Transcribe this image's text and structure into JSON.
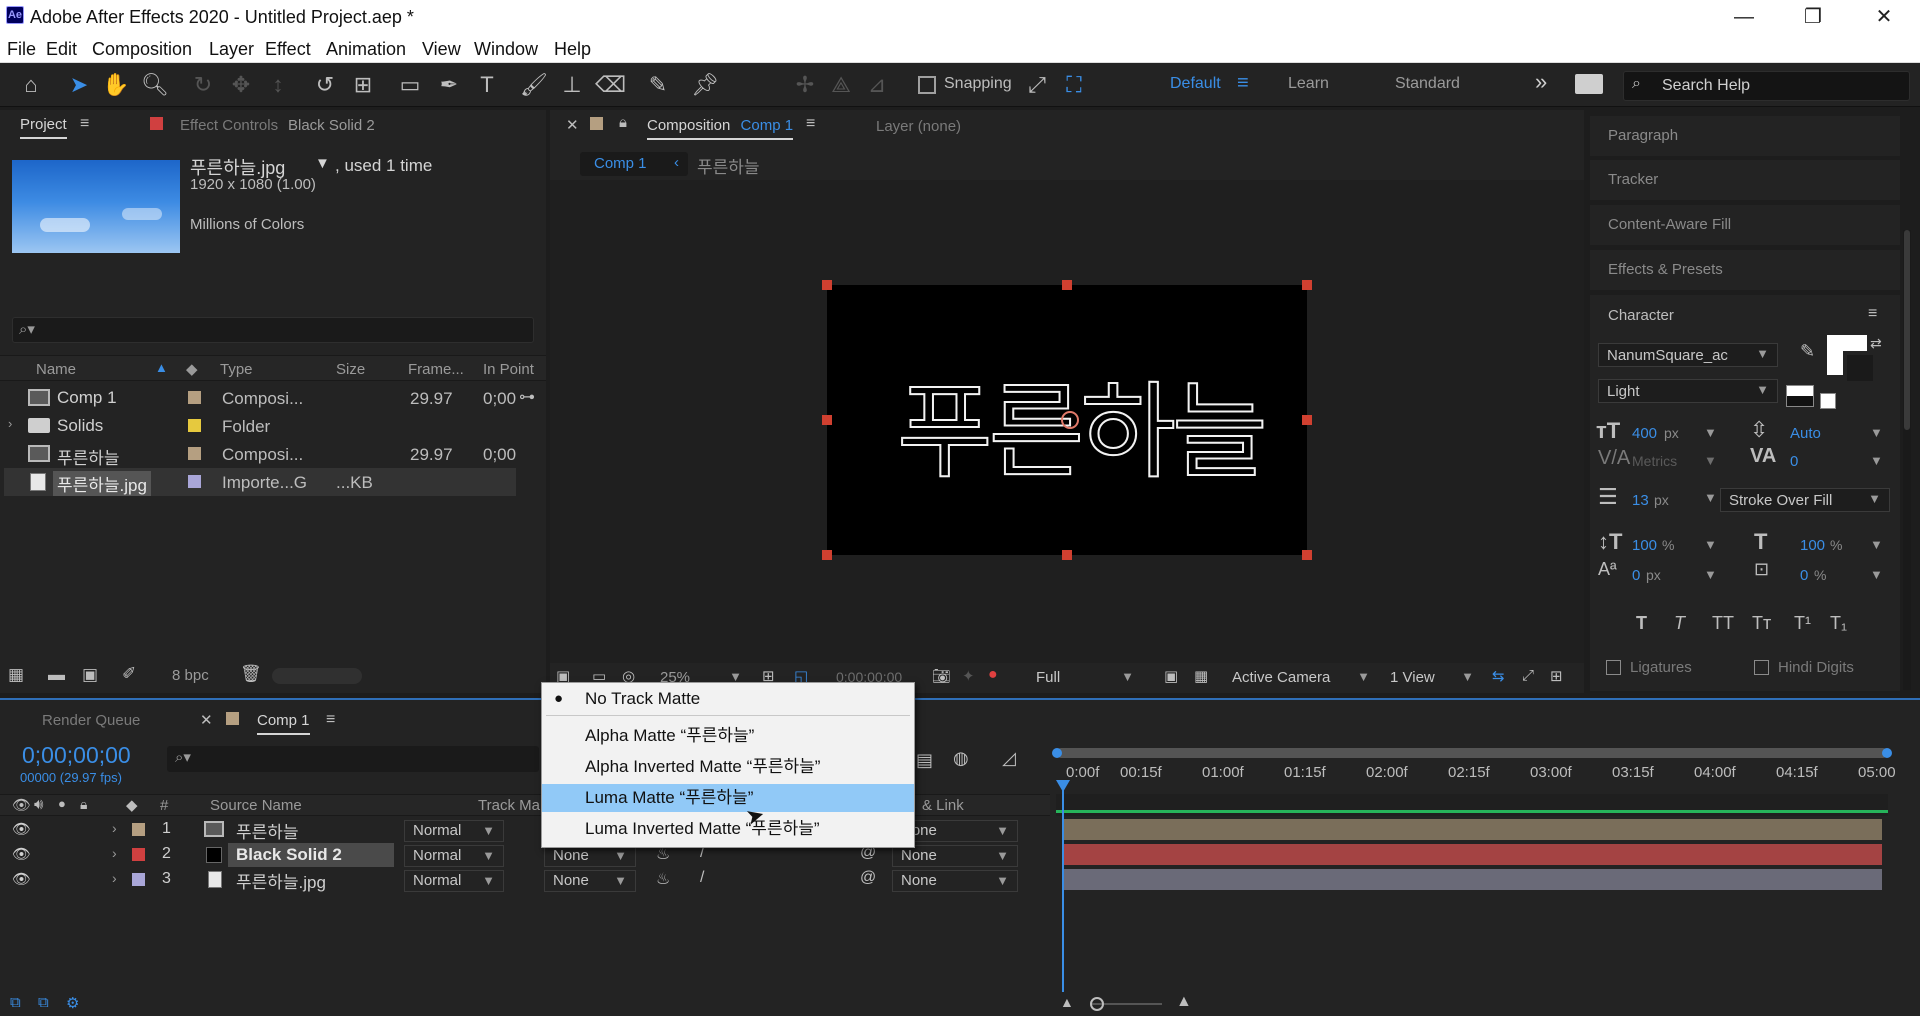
{
  "app": {
    "logo": "Ae",
    "title": "Adobe After Effects 2020 - Untitled Project.aep *",
    "window_controls": {
      "minimize": "—",
      "restore": "❐",
      "close": "✕"
    }
  },
  "menu": [
    "File",
    "Edit",
    "Composition",
    "Layer",
    "Effect",
    "Animation",
    "View",
    "Window",
    "Help"
  ],
  "toolbar": {
    "snapping_label": "Snapping",
    "workspaces": {
      "default": "Default",
      "learn": "Learn",
      "standard": "Standard"
    },
    "search_placeholder": "Search Help",
    "expand_glyph": "»",
    "menu_glyph": "≡"
  },
  "project_panel": {
    "tab_project": "Project",
    "tab_effect_controls": "Effect Controls",
    "effect_controls_target": "Black Solid 2",
    "selected_item": {
      "name": "푸른하늘.jpg",
      "used": ", used 1 time",
      "dimensions": "1920 x 1080 (1.00)",
      "colors": "Millions of Colors"
    },
    "search_placeholder": "",
    "columns": {
      "name": "Name",
      "type": "Type",
      "size": "Size",
      "frame_rate": "Frame...",
      "in_point": "In Point"
    },
    "items": [
      {
        "name": "Comp 1",
        "type": "Composi...",
        "size": "",
        "frame_rate": "29.97",
        "in_point": "0;00",
        "swatch": "#b59f81",
        "icon": "composition-icon"
      },
      {
        "name": "Solids",
        "type": "Folder",
        "size": "",
        "frame_rate": "",
        "in_point": "",
        "swatch": "#e6c93e",
        "icon": "folder-icon"
      },
      {
        "name": "푸른하늘",
        "type": "Composi...",
        "size": "",
        "frame_rate": "29.97",
        "in_point": "0;00",
        "swatch": "#b59f81",
        "icon": "composition-icon"
      },
      {
        "name": "푸른하늘.jpg",
        "type": "Importe...G",
        "size": "...KB",
        "frame_rate": "",
        "in_point": "",
        "swatch": "#a9a6d8",
        "icon": "image-file-icon"
      }
    ],
    "bpc": "8 bpc"
  },
  "composition_panel": {
    "tab_label": "Composition",
    "tab_comp": "Comp 1",
    "layer_tab": "Layer (none)",
    "breadcrumb": {
      "current": "Comp 1",
      "parent": "푸른하늘"
    },
    "canvas_text": "푸른하늘",
    "zoom": "25%",
    "timecode": "0;00;00;00",
    "resolution": "Full",
    "camera": "Active Camera",
    "views": "1 View"
  },
  "right_panels": {
    "paragraph": "Paragraph",
    "tracker": "Tracker",
    "content_aware_fill": "Content-Aware Fill",
    "effects_presets": "Effects & Presets",
    "character": {
      "title": "Character",
      "font_family": "NanumSquare_ac",
      "font_style": "Light",
      "font_size": "400",
      "font_size_unit": "px",
      "leading": "Auto",
      "kerning": "Metrics",
      "tracking": "0",
      "stroke_width": "13",
      "stroke_unit": "px",
      "stroke_mode": "Stroke Over Fill",
      "vertical_scale": "100",
      "horizontal_scale": "100",
      "percent": "%",
      "baseline_shift": "0",
      "baseline_unit": "px",
      "tsume": "0",
      "ligatures": "Ligatures",
      "hindi_digits": "Hindi Digits",
      "style_buttons": [
        "T",
        "T",
        "TT",
        "Tт",
        "T¹",
        "T₁"
      ]
    }
  },
  "timeline": {
    "tab_render_queue": "Render Queue",
    "tab_comp": "Comp 1",
    "timecode": "0;00;00;00",
    "frame_info": "00000 (29.97 fps)",
    "columns": {
      "source_name": "Source Name",
      "track_matte": "Track Ma",
      "parent_link": "& Link"
    },
    "ruler": [
      "0:00f",
      "00:15f",
      "01:00f",
      "01:15f",
      "02:00f",
      "02:15f",
      "03:00f",
      "03:15f",
      "04:00f",
      "04:15f",
      "05:00"
    ],
    "layers": [
      {
        "num": "1",
        "name": "푸른하늘",
        "mode": "Normal",
        "matte": "",
        "parent": "None",
        "swatch": "#b59f81",
        "bar": "#7a6e5a"
      },
      {
        "num": "2",
        "name": "Black Solid 2",
        "mode": "Normal",
        "matte": "None",
        "parent": "None",
        "swatch": "#d04040",
        "bar": "#a44343"
      },
      {
        "num": "3",
        "name": "푸른하늘.jpg",
        "mode": "Normal",
        "matte": "None",
        "parent": "None",
        "swatch": "#a9a6d8",
        "bar": "#6a6a78"
      }
    ]
  },
  "track_matte_menu": {
    "items": [
      {
        "label": "No Track Matte",
        "checked": true,
        "selected": false
      },
      {
        "label": "Alpha Matte “푸른하늘”",
        "checked": false,
        "selected": false
      },
      {
        "label": "Alpha Inverted Matte “푸른하늘”",
        "checked": false,
        "selected": false
      },
      {
        "label": "Luma Matte “푸른하늘”",
        "checked": false,
        "selected": true
      },
      {
        "label": "Luma Inverted Matte “푸른하늘”",
        "checked": false,
        "selected": false
      }
    ]
  }
}
